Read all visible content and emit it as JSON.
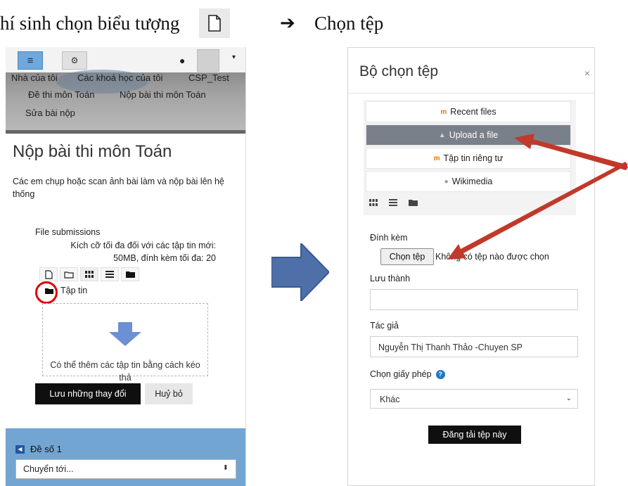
{
  "caption": {
    "left_text": "hí sinh chọn biểu tượng",
    "arrow_glyph": "➔",
    "right_text": "Chọn tệp",
    "icon": "file-icon"
  },
  "left_screen": {
    "topbar": {
      "menu_icon": "≡",
      "settings_icon": "⚙",
      "chat_icon": "●",
      "caret_icon": "▾"
    },
    "breadcrumb": {
      "items": [
        "Nhà của tôi",
        "Các khoá học của tôi",
        "CSP_Test",
        "Đề thi môn Toán",
        "Nộp bài thi môn Toán",
        "Sửa bài nộp"
      ]
    },
    "page_title": "Nộp bài thi môn Toán",
    "description": "Các em chụp hoặc scan ảnh bài làm và nộp bài lên hệ thống",
    "file_submissions": {
      "label": "File submissions",
      "size_line1": "Kích cỡ tối đa đối với các tập tin mới:",
      "size_line2": "50MB, đính kèm tối đa: 20",
      "folder_label": "Tập tin",
      "drop_text": "Có thể thêm các tập tin bằng cách kéo thả"
    },
    "buttons": {
      "save": "Lưu những thay đổi",
      "cancel": "Huỷ bỏ"
    },
    "bottom": {
      "section_label": "Đề số 1",
      "jump_placeholder": "Chuyển tới..."
    }
  },
  "file_picker": {
    "title": "Bộ chọn tệp",
    "close_icon": "×",
    "repositories": [
      {
        "label": "Recent files",
        "icon": "moodle-icon",
        "active": false
      },
      {
        "label": "Upload a file",
        "icon": "upload-icon",
        "active": true
      },
      {
        "label": "Tập tin riêng tư",
        "icon": "moodle-icon",
        "active": false
      },
      {
        "label": "Wikimedia",
        "icon": "wikimedia-icon",
        "active": false
      }
    ],
    "attachment_label": "Đính kèm",
    "choose_button": "Chọn tệp",
    "choose_status": "Không có tệp nào được chọn",
    "save_as_label": "Lưu thành",
    "save_as_value": "",
    "author_label": "Tác giả",
    "author_value": "Nguyễn Thị Thanh Thảo -Chuyen SP",
    "license_label": "Chọn giấy phép",
    "license_value": "Khác",
    "upload_button": "Đăng tải tệp này"
  },
  "colors": {
    "annotation_red": "#c0392b",
    "circle_red": "#e00000",
    "big_arrow_fill": "#4f6fa8",
    "drop_arrow_fill": "#6d8fd3",
    "panel_blue": "#73a5d2",
    "active_repo": "#7a8089"
  }
}
